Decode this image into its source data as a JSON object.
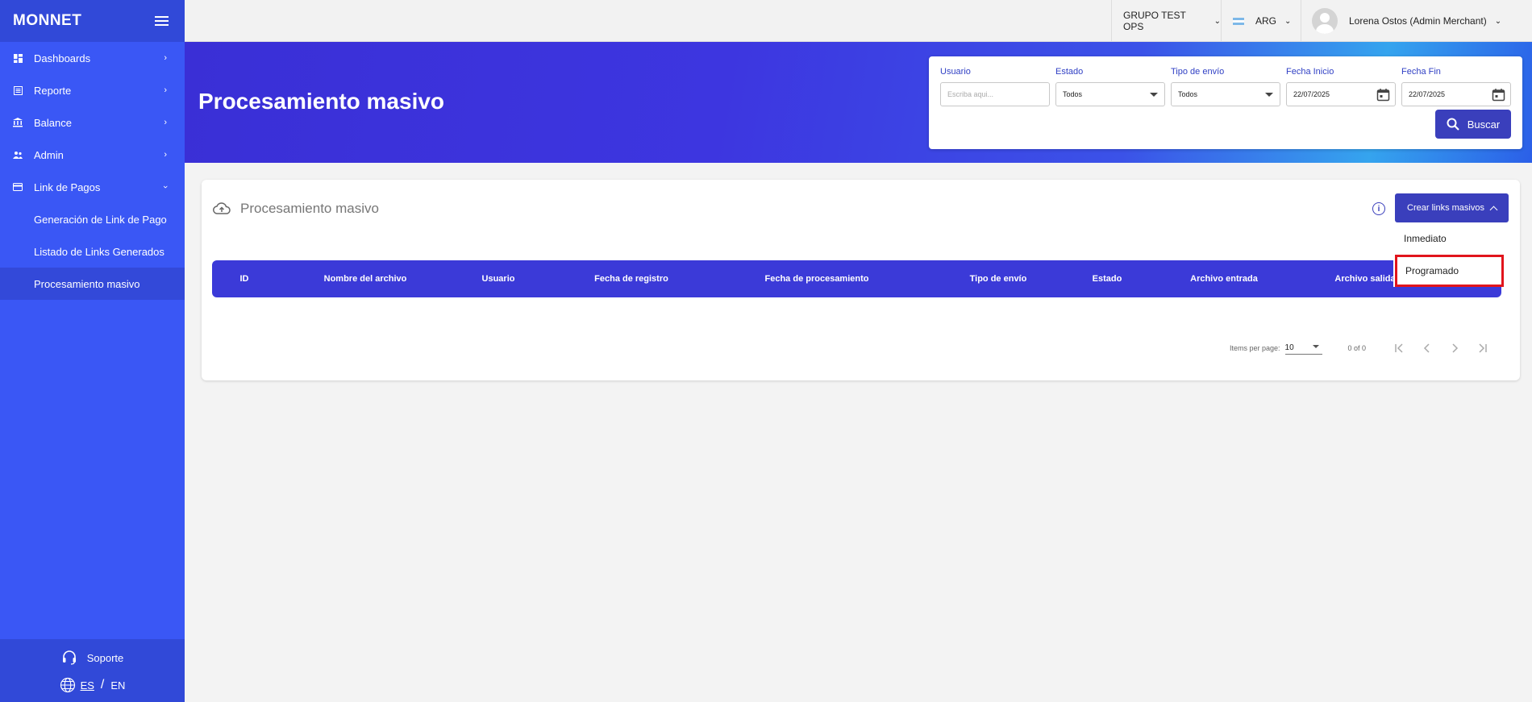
{
  "app": {
    "logo": "MONNET"
  },
  "sidebar": {
    "items": [
      {
        "label": "Dashboards",
        "icon": "dashboard-icon"
      },
      {
        "label": "Reporte",
        "icon": "report-icon"
      },
      {
        "label": "Balance",
        "icon": "bank-icon"
      },
      {
        "label": "Admin",
        "icon": "users-icon"
      },
      {
        "label": "Link de Pagos",
        "icon": "card-icon",
        "expanded": true
      }
    ],
    "subitems": [
      {
        "label": "Generación de Link de Pago"
      },
      {
        "label": "Listado de Links Generados"
      },
      {
        "label": "Procesamiento masivo",
        "active": true
      }
    ],
    "support": "Soporte",
    "lang": {
      "es": "ES",
      "sep": "/",
      "en": "EN"
    }
  },
  "topbar": {
    "group": "GRUPO TEST OPS",
    "country": "ARG",
    "user": "Lorena Ostos (Admin Merchant)"
  },
  "banner": {
    "title": "Procesamiento masivo"
  },
  "filters": {
    "usuario": {
      "label": "Usuario",
      "placeholder": "Escriba aqui..."
    },
    "estado": {
      "label": "Estado",
      "value": "Todos"
    },
    "tipo_envio": {
      "label": "Tipo de envío",
      "value": "Todos"
    },
    "fecha_inicio": {
      "label": "Fecha Inicio",
      "value": "22/07/2025"
    },
    "fecha_fin": {
      "label": "Fecha Fin",
      "value": "22/07/2025"
    },
    "buscar": "Buscar"
  },
  "card": {
    "title": "Procesamiento masivo",
    "info": "i",
    "create_button": "Crear links masivos",
    "columns": [
      "ID",
      "Nombre del archivo",
      "Usuario",
      "Fecha de registro",
      "Fecha de procesamiento",
      "Tipo de envío",
      "Estado",
      "Archivo entrada",
      "Archivo salida"
    ],
    "paginator": {
      "items_label": "Items per page:",
      "items_value": "10",
      "range": "0 of 0"
    }
  },
  "dropdown": {
    "items": [
      "Inmediato",
      "Programado"
    ]
  },
  "colors": {
    "sidebar": "#3a57f5",
    "primary_button": "#3a3fbc",
    "table_header": "#3b3ad8",
    "highlight_border": "#e1141c"
  }
}
